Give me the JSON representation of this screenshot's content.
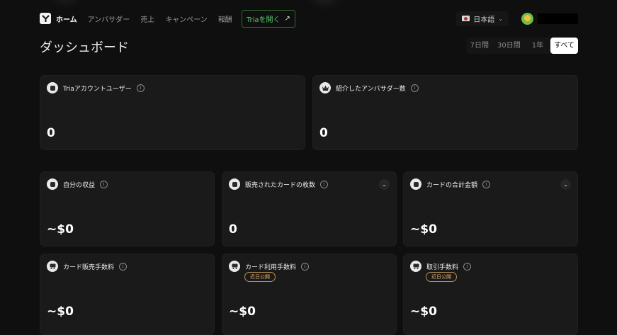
{
  "nav": {
    "items": [
      "ホーム",
      "アンバサダー",
      "売上",
      "キャンペーン",
      "報酬"
    ],
    "tria_button": "Triaを開く",
    "language": "日本語"
  },
  "page": {
    "title": "ダッシュボード",
    "ranges": [
      "7日間",
      "30日間",
      "1年",
      "すべて"
    ],
    "selected_range": "すべて"
  },
  "cards": [
    {
      "label": "Triaアカウントユーザー",
      "value": "0",
      "icon": "coin-icon"
    },
    {
      "label": "紹介したアンバサダー数",
      "value": "0",
      "icon": "crown-icon"
    },
    {
      "label": "自分の収益",
      "value": "~$0",
      "icon": "coin-icon"
    },
    {
      "label": "販売されたカードの枚数",
      "value": "0",
      "icon": "coin-icon"
    },
    {
      "label": "カードの合計金額",
      "value": "~$0",
      "icon": "coin-icon"
    },
    {
      "label": "カード販売手数料",
      "value": "~$0",
      "icon": "cart-icon"
    },
    {
      "label": "カード利用手数料",
      "value": "~$0",
      "badge": "近日公開",
      "icon": "cart-icon"
    },
    {
      "label": "取引手数料",
      "value": "~$0",
      "badge": "近日公開",
      "icon": "cart-icon"
    }
  ],
  "colors": {
    "accent": "#52c866",
    "background": "#0f0f0f",
    "card": "#1a1a1a",
    "badge": "#d8b27a"
  }
}
